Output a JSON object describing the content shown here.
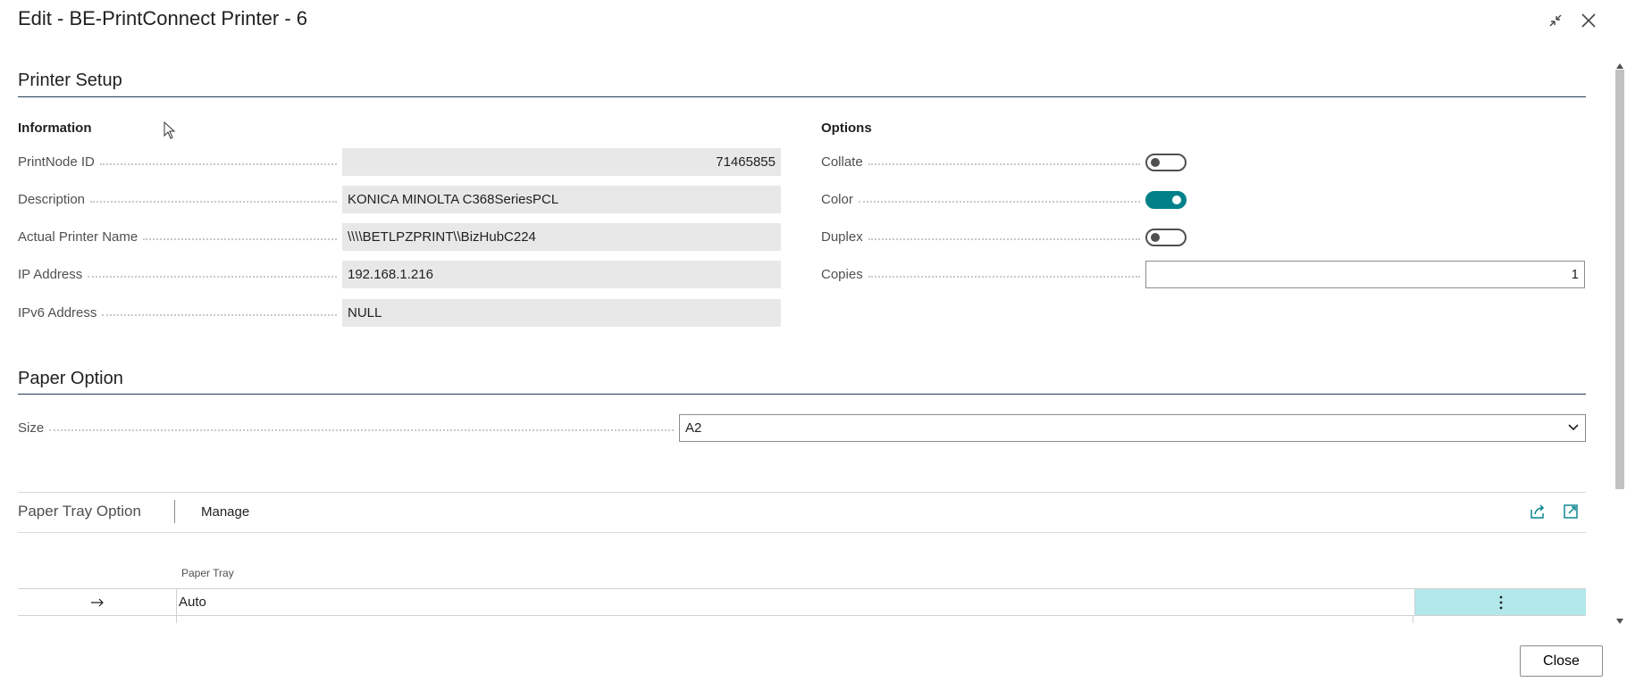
{
  "window": {
    "title": "Edit - BE-PrintConnect Printer - 6"
  },
  "printer_setup": {
    "heading": "Printer Setup",
    "information": {
      "heading": "Information",
      "fields": [
        {
          "label": "PrintNode ID",
          "value": "71465855"
        },
        {
          "label": "Description",
          "value": "KONICA MINOLTA C368SeriesPCL"
        },
        {
          "label": "Actual Printer Name",
          "value": "\\\\\\\\BETLPZPRINT\\\\BizHubC224"
        },
        {
          "label": "IP Address",
          "value": "192.168.1.216"
        },
        {
          "label": "IPv6 Address",
          "value": "NULL"
        }
      ]
    },
    "options": {
      "heading": "Options",
      "collate": {
        "label": "Collate",
        "on": false
      },
      "color": {
        "label": "Color",
        "on": true
      },
      "duplex": {
        "label": "Duplex",
        "on": false
      },
      "copies": {
        "label": "Copies",
        "value": "1"
      }
    }
  },
  "paper_option": {
    "heading": "Paper Option",
    "size": {
      "label": "Size",
      "value": "A2"
    }
  },
  "paper_tray": {
    "heading": "Paper Tray Option",
    "manage_label": "Manage",
    "column_header": "Paper Tray",
    "rows": [
      {
        "value": "Auto"
      }
    ]
  },
  "footer": {
    "close_label": "Close"
  },
  "colors": {
    "accent": "#00818a",
    "selected_cell": "#b2e8ea"
  }
}
